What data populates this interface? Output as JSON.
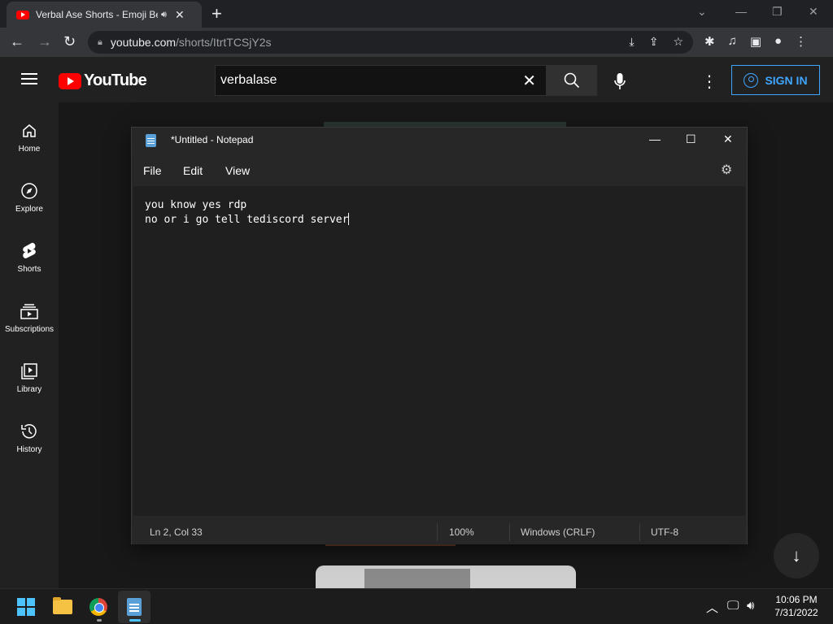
{
  "browser": {
    "tab_title": "Verbal Ase Shorts - Emoji Be...",
    "url_host": "youtube.com",
    "url_path": "/shorts/ItrtTCSjY2s"
  },
  "youtube": {
    "logo_text": "YouTube",
    "search_value": "verbalase",
    "signin_label": "SIGN IN",
    "sidebar": [
      {
        "label": "Home",
        "icon": "home-icon"
      },
      {
        "label": "Explore",
        "icon": "compass-icon"
      },
      {
        "label": "Shorts",
        "icon": "shorts-icon"
      },
      {
        "label": "Subscriptions",
        "icon": "subscriptions-icon"
      },
      {
        "label": "Library",
        "icon": "library-icon"
      },
      {
        "label": "History",
        "icon": "history-icon"
      }
    ]
  },
  "notepad": {
    "title": "*Untitled - Notepad",
    "menu": [
      "File",
      "Edit",
      "View"
    ],
    "lines": [
      "you know yes rdp",
      "no or i go tell tediscord server"
    ],
    "status": {
      "position": "Ln 2, Col 33",
      "zoom": "100%",
      "line_ending": "Windows (CRLF)",
      "encoding": "UTF-8"
    }
  },
  "taskbar": {
    "time": "10:06 PM",
    "date": "7/31/2022"
  }
}
